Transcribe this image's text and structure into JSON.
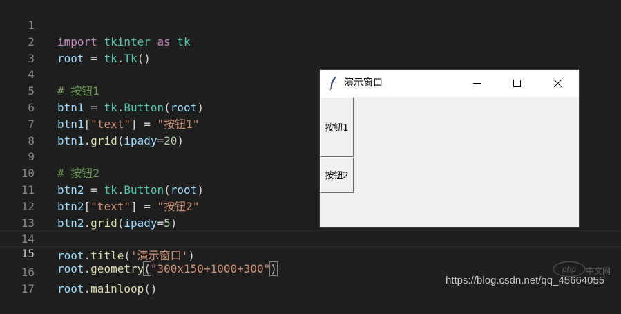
{
  "editor": {
    "line_numbers": [
      "1",
      "2",
      "3",
      "4",
      "5",
      "6",
      "7",
      "8",
      "9",
      "10",
      "11",
      "12",
      "13",
      "14",
      "15",
      "16",
      "17"
    ],
    "current_line": "15",
    "tokens": {
      "l1_import": "import",
      "l1_tkinter": "tkinter",
      "l1_as": "as",
      "l1_tk": "tk",
      "l2_root": "root",
      "l2_eq": " = ",
      "l2_tk": "tk",
      "l2_dot": ".",
      "l2_Tk": "Tk",
      "l2_paren": "()",
      "l4_comment": "# 按钮1",
      "l5_btn1": "btn1",
      "l5_eq": " = ",
      "l5_tk": "tk",
      "l5_dot": ".",
      "l5_Button": "Button",
      "l5_open": "(",
      "l5_root": "root",
      "l5_close": ")",
      "l6_btn1": "btn1",
      "l6_open": "[",
      "l6_key": "\"text\"",
      "l6_close": "]",
      "l6_eq": " = ",
      "l6_val": "\"按钮1\"",
      "l7_btn1": "btn1",
      "l7_dot": ".",
      "l7_grid": "grid",
      "l7_open": "(",
      "l7_arg": "ipady",
      "l7_eq": "=",
      "l7_num": "20",
      "l7_close": ")",
      "l9_comment": "# 按钮2",
      "l10_btn2": "btn2",
      "l10_eq": " = ",
      "l10_tk": "tk",
      "l10_dot": ".",
      "l10_Button": "Button",
      "l10_open": "(",
      "l10_root": "root",
      "l10_close": ")",
      "l11_btn2": "btn2",
      "l11_open": "[",
      "l11_key": "\"text\"",
      "l11_close": "]",
      "l11_eq": " = ",
      "l11_val": "\"按钮2\"",
      "l12_btn2": "btn2",
      "l12_dot": ".",
      "l12_grid": "grid",
      "l12_open": "(",
      "l12_arg": "ipady",
      "l12_eq": "=",
      "l12_num": "5",
      "l12_close": ")",
      "l14_root": "root",
      "l14_dot": ".",
      "l14_title": "title",
      "l14_open": "(",
      "l14_str": "'演示窗口'",
      "l14_close": ")",
      "l15_root": "root",
      "l15_dot": ".",
      "l15_geometry": "geometry",
      "l15_open": "(",
      "l15_str": "\"300x150+1000+300\"",
      "l15_close": ")",
      "l16_root": "root",
      "l16_dot": ".",
      "l16_mainloop": "mainloop",
      "l16_paren": "()"
    }
  },
  "tk_window": {
    "title": "演示窗口",
    "icon": "feather-icon",
    "buttons": [
      "minimize-icon",
      "maximize-icon",
      "close-icon"
    ],
    "button1_label": "按钮1",
    "button2_label": "按钮2"
  },
  "watermark": {
    "text": "https://blog.csdn.net/qq_45664055",
    "logo_text": "php",
    "logo_suffix": "中文网"
  },
  "colors": {
    "editor_bg": "#1e1e1e",
    "keyword": "#c586c0",
    "variable": "#9cdcfe",
    "module": "#4ec9b0",
    "function": "#dcdcaa",
    "string": "#ce9178",
    "number": "#b5cea8",
    "comment": "#6a9955",
    "window_bg": "#f0f0f0"
  }
}
